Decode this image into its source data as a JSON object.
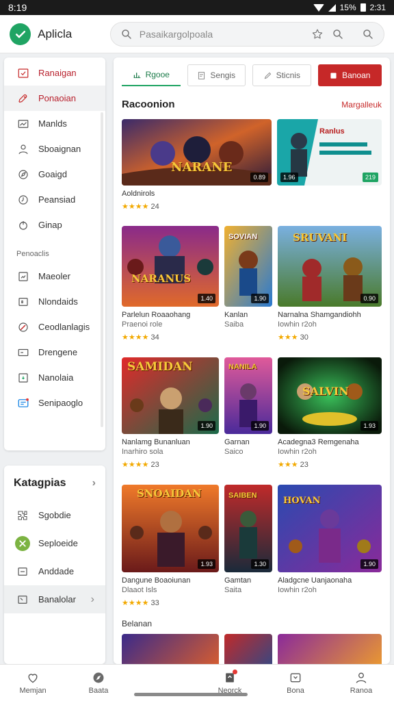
{
  "status": {
    "time": "8:19",
    "battery": "15%",
    "clock": "2:31"
  },
  "header": {
    "app_title": "Aplicla",
    "search_placeholder": "Pasaikargolpoala"
  },
  "sidebar": {
    "items": [
      {
        "label": "Ranaigan",
        "icon": "inbox-icon",
        "state": "active"
      },
      {
        "label": "Ponaoian",
        "icon": "rocket-icon",
        "state": "hover"
      },
      {
        "label": "Manlds",
        "icon": "mail-icon",
        "state": ""
      },
      {
        "label": "Sboaignan",
        "icon": "user-icon",
        "state": ""
      },
      {
        "label": "Goaigd",
        "icon": "compass-icon",
        "state": ""
      },
      {
        "label": "Peansiad",
        "icon": "clock-icon",
        "state": ""
      },
      {
        "label": "Ginap",
        "icon": "power-icon",
        "state": ""
      }
    ],
    "section_label": "Penoaclis",
    "items2": [
      {
        "label": "Maeoler",
        "icon": "chart-icon"
      },
      {
        "label": "Nlondaids",
        "icon": "grid-icon"
      },
      {
        "label": "Ceodlanlagis",
        "icon": "pie-icon"
      },
      {
        "label": "Drengene",
        "icon": "card-icon"
      },
      {
        "label": "Nanolaia",
        "icon": "download-icon"
      },
      {
        "label": "Senipaoglo",
        "icon": "message-icon"
      }
    ]
  },
  "categories": {
    "title": "Katagpias",
    "items": [
      {
        "label": "Sgobdie",
        "icon": "puzzle-icon"
      },
      {
        "label": "Seploeide",
        "icon": "tools-icon"
      },
      {
        "label": "Anddade",
        "icon": "list-icon"
      },
      {
        "label": "Banalolar",
        "icon": "folder-icon"
      }
    ]
  },
  "tabs": [
    {
      "label": "Rgooe",
      "icon": "bar-icon"
    },
    {
      "label": "Sengis",
      "icon": "doc-icon"
    },
    {
      "label": "Sticnis",
      "icon": "edit-icon"
    },
    {
      "label": "Banoan",
      "icon": "box-icon"
    }
  ],
  "section": {
    "title": "Racoonion",
    "more": "Margalleuk"
  },
  "cards": [
    {
      "title": "Aoldnirols",
      "subtitle": "",
      "stars": "★★★★",
      "rating": "24",
      "badge": "0.89",
      "art_text": "NARANE"
    },
    {
      "title": "",
      "subtitle": "",
      "stars": "",
      "rating": "",
      "badge": "1.96",
      "side_badge": "219",
      "art_text": "Ranlus"
    },
    {
      "title": "Parlelun Roaaohang",
      "subtitle": "Praenoi role",
      "stars": "★★★★",
      "rating": "34",
      "badge": "1.40",
      "art_text": "NARANUS"
    },
    {
      "title": "Kanlan",
      "subtitle": "Saiba",
      "stars": "",
      "rating": "",
      "badge": "1.90",
      "art_text": "SOVIAN"
    },
    {
      "title": "Narnalna Shamgandiohh",
      "subtitle": "Iowhin r2oh",
      "stars": "★★★",
      "rating": "30",
      "badge": "0.90",
      "art_text": "SRUVANI"
    },
    {
      "title": "Nanlamg Bunanluan",
      "subtitle": "Inarhiro sola",
      "stars": "★★★★",
      "rating": "23",
      "badge": "1.90",
      "art_text": "SAMIDAN"
    },
    {
      "title": "Garnan",
      "subtitle": "Saico",
      "stars": "",
      "rating": "",
      "badge": "1.90",
      "art_text": "NANILA"
    },
    {
      "title": "Acadegna3 Remgenaha",
      "subtitle": "Iowhin r2oh",
      "stars": "★★★",
      "rating": "23",
      "badge": "1.93",
      "art_text": "SALVIN"
    },
    {
      "title": "Dangune Boaoiunan",
      "subtitle": "Dlaaot Isls",
      "stars": "★★★★",
      "rating": "33",
      "badge": "1.93",
      "art_text": "SNOAIDAN"
    },
    {
      "title": "Gamtan",
      "subtitle": "Saita",
      "stars": "",
      "rating": "",
      "badge": "1.30",
      "art_text": "SAIBEN"
    },
    {
      "title": "Aladgcne Uanjaonaha",
      "subtitle": "Iowhin r2oh",
      "stars": "",
      "rating": "",
      "badge": "1.90",
      "art_text": "HOVAN"
    }
  ],
  "section2": {
    "title": "Belanan"
  },
  "bottom_nav": [
    {
      "label": "Memjan",
      "icon": "heart-icon"
    },
    {
      "label": "Baata",
      "icon": "explore-icon"
    },
    {
      "label": "",
      "icon": "blank"
    },
    {
      "label": "Neorck",
      "icon": "bookmark-icon"
    },
    {
      "label": "Bona",
      "icon": "gift-icon"
    },
    {
      "label": "Ranoa",
      "icon": "person-icon"
    }
  ],
  "colors": {
    "accent": "#c62828",
    "brand": "#1fa463",
    "star": "#f2a900"
  }
}
